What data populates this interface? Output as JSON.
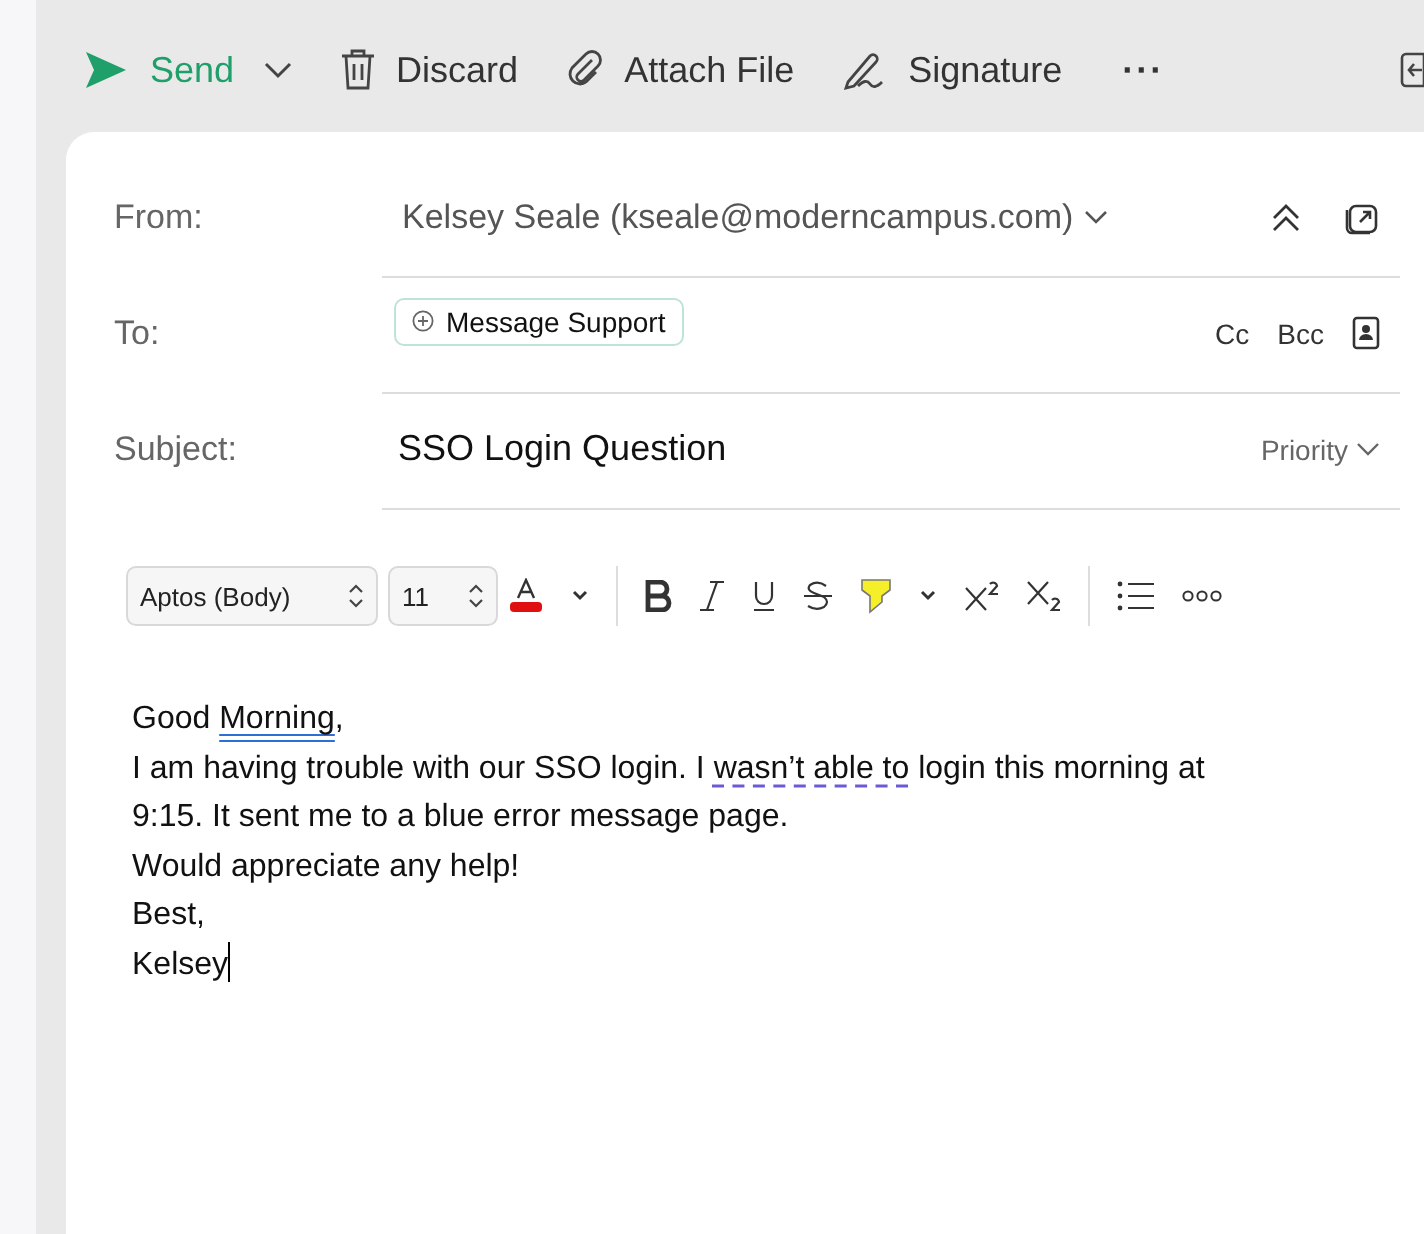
{
  "toolbar": {
    "send": "Send",
    "actions": [
      {
        "kind": "discard",
        "label": "Discard"
      },
      {
        "kind": "attach",
        "label": "Attach File"
      },
      {
        "kind": "signature",
        "label": "Signature"
      }
    ],
    "more": "···"
  },
  "from": {
    "label": "From:",
    "value": "Kelsey Seale (kseale@moderncampus.com)"
  },
  "to": {
    "label": "To:",
    "recipients": [
      "Message Support"
    ],
    "cc": "Cc",
    "bcc": "Bcc"
  },
  "subject": {
    "label": "Subject:",
    "value": "SSO Login Question",
    "priority": "Priority"
  },
  "format": {
    "font": "Aptos (Body)",
    "size": "11"
  },
  "body": [
    {
      "segments": [
        {
          "text": "Good "
        },
        {
          "text": "Morning",
          "kind": "spelling"
        },
        {
          "text": ","
        }
      ]
    },
    {
      "segments": [
        {
          "text": "I am having trouble with our SSO login. I "
        },
        {
          "text": "wasn’t able to",
          "kind": "grammar"
        },
        {
          "text": " login this morning at"
        }
      ]
    },
    {
      "segments": [
        {
          "text": "9:15. It sent me to a blue error message page."
        }
      ]
    },
    {
      "segments": [
        {
          "text": "Would appreciate any help!"
        }
      ]
    },
    {
      "segments": [
        {
          "text": "Best,"
        }
      ]
    },
    {
      "segments": [
        {
          "text": "Kelsey"
        }
      ]
    }
  ]
}
